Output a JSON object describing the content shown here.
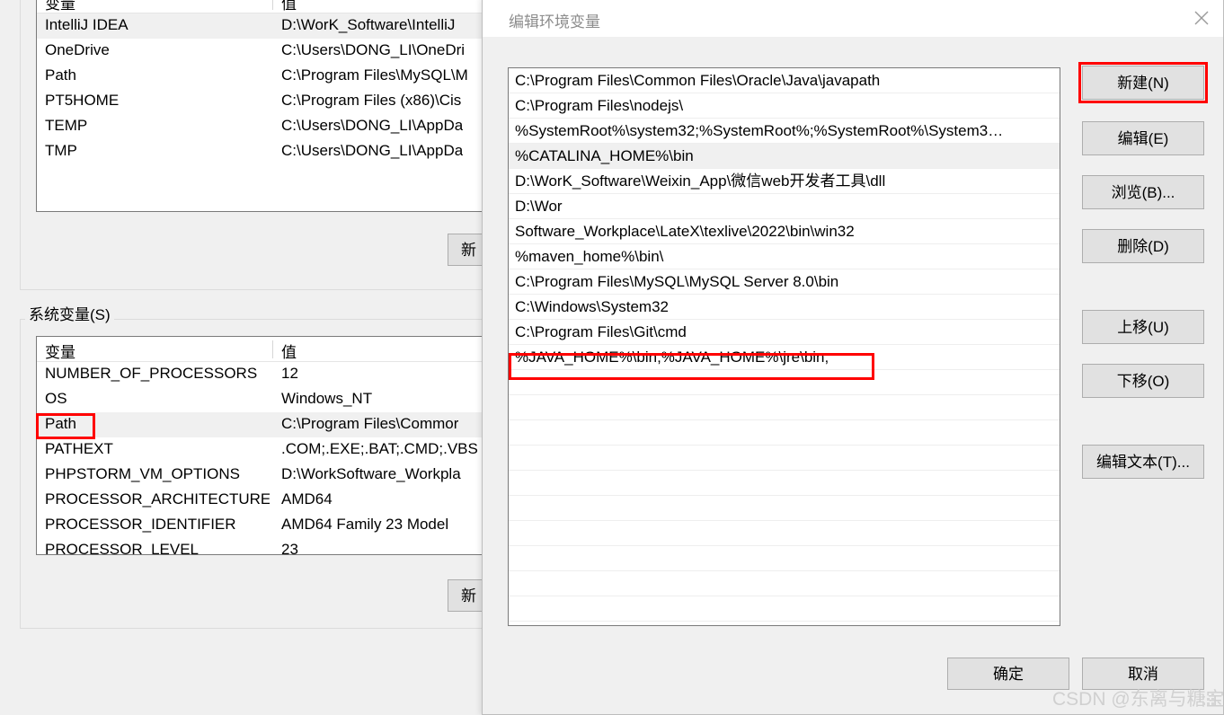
{
  "background_window": {
    "user_variables": {
      "columns": [
        "变量",
        "值"
      ],
      "rows": [
        {
          "name": "IntelliJ IDEA",
          "value": "D:\\WorK_Software\\IntelliJ",
          "selected": true
        },
        {
          "name": "OneDrive",
          "value": "C:\\Users\\DONG_LI\\OneDri",
          "selected": false
        },
        {
          "name": "Path",
          "value": "C:\\Program Files\\MySQL\\M",
          "selected": false
        },
        {
          "name": "PT5HOME",
          "value": "C:\\Program Files (x86)\\Cis",
          "selected": false
        },
        {
          "name": "TEMP",
          "value": "C:\\Users\\DONG_LI\\AppDa",
          "selected": false
        },
        {
          "name": "TMP",
          "value": "C:\\Users\\DONG_LI\\AppDa",
          "selected": false
        }
      ],
      "new_button_label": "新"
    },
    "system_variables": {
      "legend": "系统变量(S)",
      "columns": [
        "变量",
        "值"
      ],
      "rows": [
        {
          "name": "NUMBER_OF_PROCESSORS",
          "value": "12",
          "selected": false
        },
        {
          "name": "OS",
          "value": "Windows_NT",
          "selected": false
        },
        {
          "name": "Path",
          "value": "C:\\Program Files\\Commor",
          "selected": true
        },
        {
          "name": "PATHEXT",
          "value": ".COM;.EXE;.BAT;.CMD;.VBS",
          "selected": false
        },
        {
          "name": "PHPSTORM_VM_OPTIONS",
          "value": "D:\\WorkSoftware_Workpla",
          "selected": false
        },
        {
          "name": "PROCESSOR_ARCHITECTURE",
          "value": "AMD64",
          "selected": false
        },
        {
          "name": "PROCESSOR_IDENTIFIER",
          "value": "AMD64 Family 23 Model",
          "selected": false
        },
        {
          "name": "PROCESSOR_LEVEL",
          "value": "23",
          "selected": false
        }
      ],
      "new_button_label": "新"
    }
  },
  "dialog": {
    "title": "编辑环境变量",
    "close_icon": "close-icon",
    "path_entries": [
      {
        "text": "C:\\Program Files\\Common Files\\Oracle\\Java\\javapath",
        "selected": false,
        "highlighted": false
      },
      {
        "text": "C:\\Program Files\\nodejs\\",
        "selected": false,
        "highlighted": false
      },
      {
        "text": "%SystemRoot%\\system32;%SystemRoot%;%SystemRoot%\\System3…",
        "selected": false,
        "highlighted": false
      },
      {
        "text": "%CATALINA_HOME%\\bin",
        "selected": true,
        "highlighted": false
      },
      {
        "text": "D:\\WorK_Software\\Weixin_App\\微信web开发者工具\\dll",
        "selected": false,
        "highlighted": false
      },
      {
        "text": "D:\\Wor",
        "selected": false,
        "highlighted": false
      },
      {
        "text": "Software_Workplace\\LateX\\texlive\\2022\\bin\\win32",
        "selected": false,
        "highlighted": false
      },
      {
        "text": "%maven_home%\\bin\\",
        "selected": false,
        "highlighted": false
      },
      {
        "text": "C:\\Program Files\\MySQL\\MySQL Server 8.0\\bin",
        "selected": false,
        "highlighted": false
      },
      {
        "text": "C:\\Windows\\System32",
        "selected": false,
        "highlighted": false
      },
      {
        "text": "C:\\Program Files\\Git\\cmd",
        "selected": false,
        "highlighted": false
      },
      {
        "text": "%JAVA_HOME%\\bin;%JAVA_HOME%\\jre\\bin;",
        "selected": false,
        "highlighted": true
      },
      {
        "text": "",
        "selected": false,
        "highlighted": false
      },
      {
        "text": "",
        "selected": false,
        "highlighted": false
      },
      {
        "text": "",
        "selected": false,
        "highlighted": false
      },
      {
        "text": "",
        "selected": false,
        "highlighted": false
      },
      {
        "text": "",
        "selected": false,
        "highlighted": false
      },
      {
        "text": "",
        "selected": false,
        "highlighted": false
      },
      {
        "text": "",
        "selected": false,
        "highlighted": false
      },
      {
        "text": "",
        "selected": false,
        "highlighted": false
      },
      {
        "text": "",
        "selected": false,
        "highlighted": false
      },
      {
        "text": "",
        "selected": false,
        "highlighted": false
      }
    ],
    "side_buttons": [
      {
        "label": "新建(N)",
        "name": "new-button",
        "highlighted": true
      },
      {
        "label": "编辑(E)",
        "name": "edit-button",
        "highlighted": false
      },
      {
        "label": "浏览(B)...",
        "name": "browse-button",
        "highlighted": false
      },
      {
        "label": "删除(D)",
        "name": "delete-button",
        "highlighted": false
      },
      {
        "label": "上移(U)",
        "name": "move-up-button",
        "highlighted": false
      },
      {
        "label": "下移(O)",
        "name": "move-down-button",
        "highlighted": false
      },
      {
        "label": "编辑文本(T)...",
        "name": "edit-text-button",
        "highlighted": false
      }
    ],
    "ok_label": "确定",
    "cancel_label": "取消"
  },
  "watermark": "CSDN @东离与糖宝",
  "colors": {
    "highlight_red": "#ff0000",
    "dialog_bg": "#f0f0f0",
    "button_bg": "#e1e1e1",
    "selection_bg": "#f0f0f0",
    "title_text": "#8d8d8d"
  }
}
